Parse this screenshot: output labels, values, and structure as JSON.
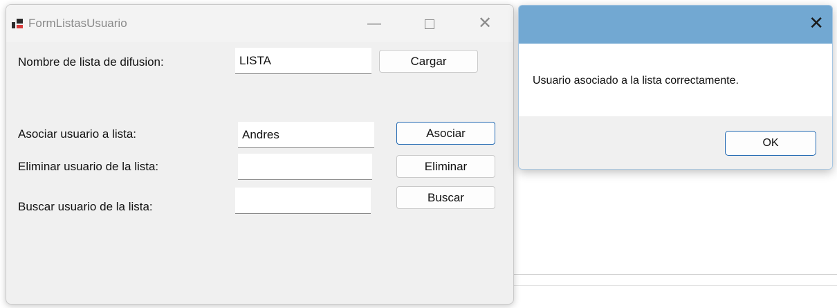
{
  "form": {
    "title": "FormListasUsuario",
    "window_controls": {
      "minimize": "—",
      "close": "✕"
    },
    "rows": {
      "lista": {
        "label": "Nombre de lista de difusion:",
        "value": "LISTA",
        "button": "Cargar"
      },
      "asociar": {
        "label": "Asociar usuario a lista:",
        "value": "Andres",
        "button": "Asociar"
      },
      "eliminar": {
        "label": "Eliminar usuario de la lista:",
        "value": "",
        "button": "Eliminar"
      },
      "buscar": {
        "label": "Buscar usuario de la lista:",
        "value": "",
        "button": "Buscar"
      }
    }
  },
  "message_box": {
    "close": "✕",
    "text": "Usuario asociado a la lista correctamente.",
    "ok_label": "OK",
    "title_bar_color": "#72a8d2",
    "accent_color": "#1f67b1"
  }
}
